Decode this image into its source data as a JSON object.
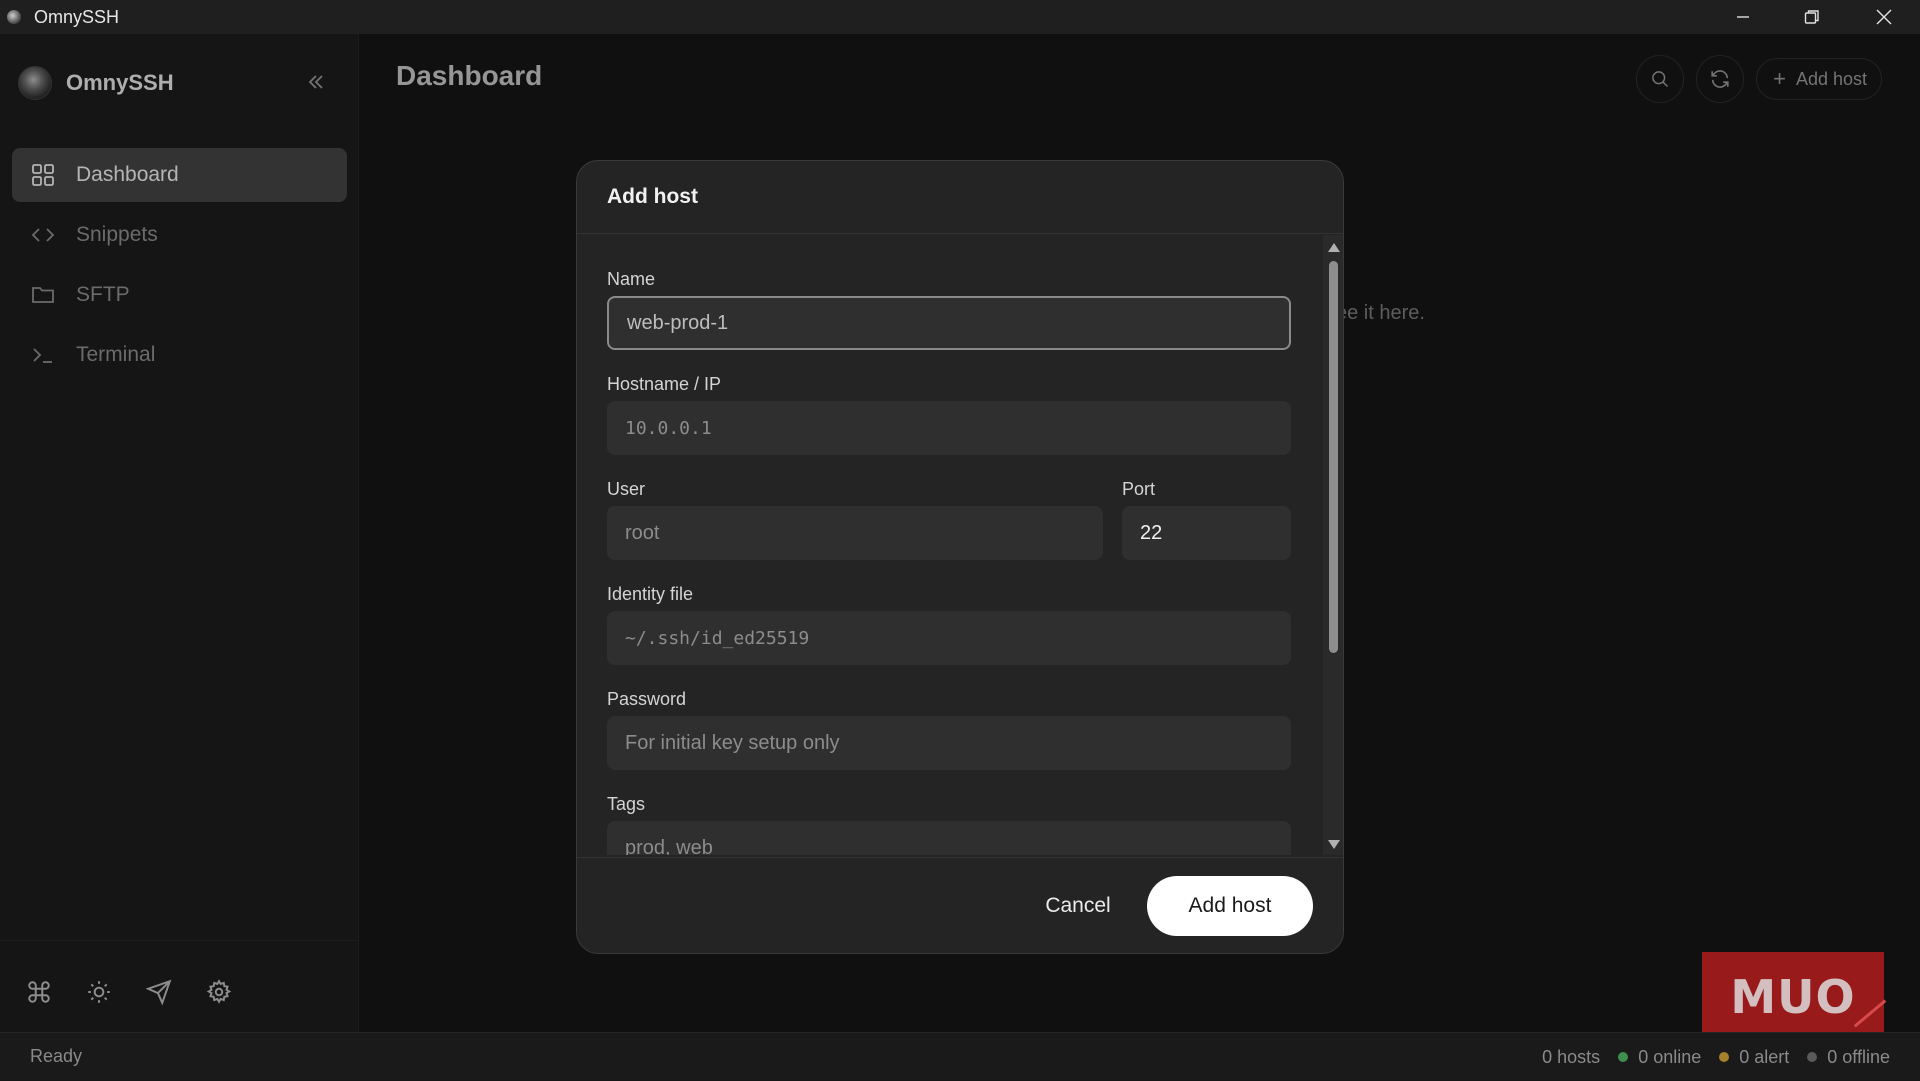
{
  "window": {
    "title": "OmnySSH"
  },
  "sidebar": {
    "brand": "OmnySSH",
    "items": [
      {
        "label": "Dashboard",
        "icon": "grid-icon",
        "active": true
      },
      {
        "label": "Snippets",
        "icon": "code-icon",
        "active": false
      },
      {
        "label": "SFTP",
        "icon": "folder-icon",
        "active": false
      },
      {
        "label": "Terminal",
        "icon": "terminal-icon",
        "active": false
      }
    ],
    "bottom_icons": [
      "command-icon",
      "sun-icon",
      "send-icon",
      "gear-icon"
    ]
  },
  "main": {
    "title": "Dashboard",
    "add_host_label": "Add host",
    "background_hint": "ee it here."
  },
  "modal": {
    "title": "Add host",
    "fields": {
      "name": {
        "label": "Name",
        "placeholder": "web-prod-1"
      },
      "hostname": {
        "label": "Hostname / IP",
        "placeholder": "10.0.0.1"
      },
      "user": {
        "label": "User",
        "placeholder": "root"
      },
      "port": {
        "label": "Port",
        "value": "22"
      },
      "identity": {
        "label": "Identity file",
        "placeholder": "~/.ssh/id_ed25519"
      },
      "password": {
        "label": "Password",
        "placeholder": "For initial key setup only"
      },
      "tags": {
        "label": "Tags",
        "placeholder": "prod, web"
      }
    },
    "cancel_label": "Cancel",
    "submit_label": "Add host"
  },
  "statusbar": {
    "status": "Ready",
    "hosts": "0 hosts",
    "online": "0 online",
    "alert": "0 alert",
    "offline": "0 offline"
  },
  "colors": {
    "online": "#3f8f4f",
    "alert": "#a4812a",
    "offline": "#5a5a5a"
  },
  "watermark": "MUO"
}
